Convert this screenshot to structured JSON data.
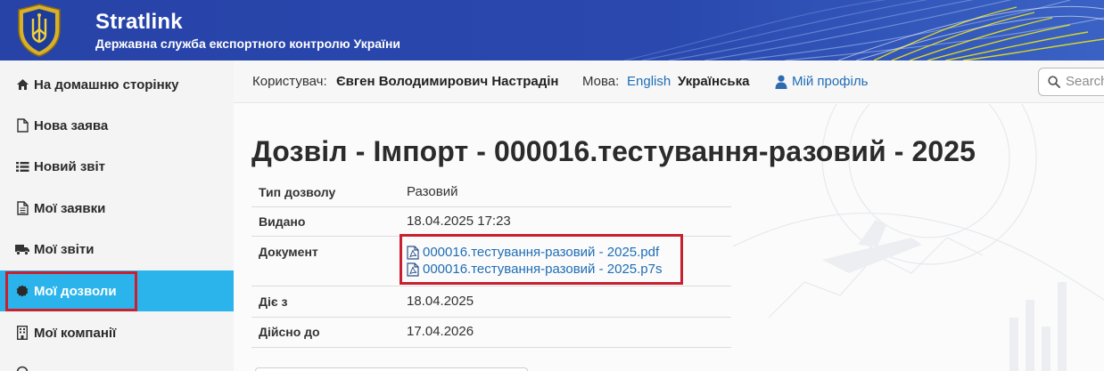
{
  "header": {
    "title": "Stratlink",
    "subtitle": "Державна служба експортного контролю України",
    "colors": {
      "background": "#2743a8",
      "accent": "#e8e21a"
    }
  },
  "sidebar": {
    "items": [
      {
        "label": "На домашню сторінку",
        "icon": "home-icon"
      },
      {
        "label": "Нова заява",
        "icon": "file-icon"
      },
      {
        "label": "Новий звіт",
        "icon": "list-icon"
      },
      {
        "label": "Мої заявки",
        "icon": "file-text-icon"
      },
      {
        "label": "Мої звіти",
        "icon": "truck-icon"
      },
      {
        "label": "Мої дозволи",
        "icon": "certificate-icon",
        "active": true
      },
      {
        "label": "Мої компанії",
        "icon": "building-icon"
      }
    ],
    "active_color": "#2bb4ec"
  },
  "userbar": {
    "user_label": "Користувач:",
    "user_name": "Євген Володимирович Настрадін",
    "language_label": "Мова:",
    "language_english": "English",
    "language_ukrainian": "Українська",
    "profile_link": "Мій профіль",
    "search_placeholder": "Search"
  },
  "permit": {
    "title": "Дозвіл - Імпорт - 000016.тестування-разовий - 2025",
    "fields": [
      {
        "label": "Тип дозволу",
        "value": "Разовий"
      },
      {
        "label": "Видано",
        "value": "18.04.2025 17:23"
      },
      {
        "label": "Документ"
      },
      {
        "label": "Діє з",
        "value": "18.04.2025"
      },
      {
        "label": "Дійсно до",
        "value": "17.04.2026"
      }
    ],
    "documents": [
      "000016.тестування-разовий - 2025.pdf",
      "000016.тестування-разовий - 2025.p7s"
    ]
  },
  "highlight_color": "#c8202f"
}
